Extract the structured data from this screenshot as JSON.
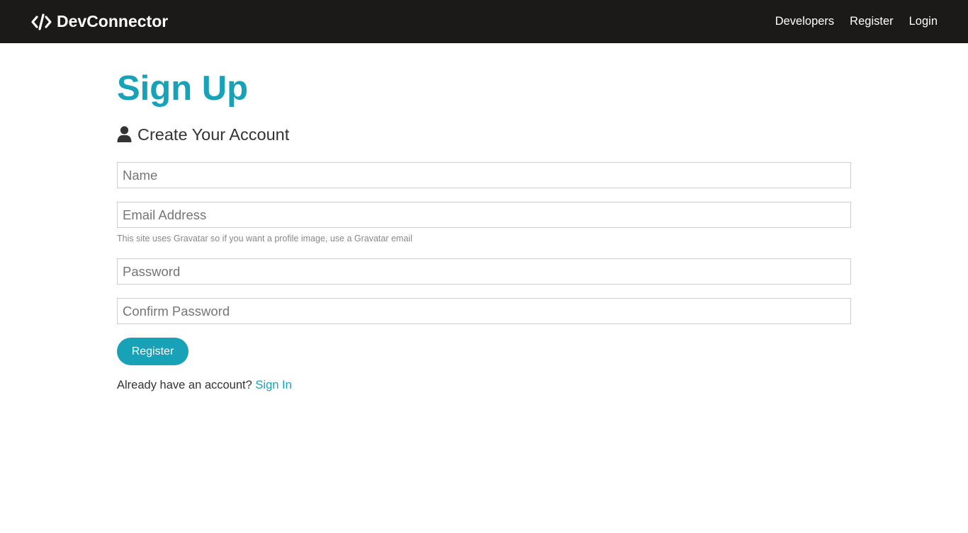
{
  "navbar": {
    "brand": "DevConnector",
    "links": [
      "Developers",
      "Register",
      "Login"
    ]
  },
  "page": {
    "title": "Sign Up",
    "lead": "Create Your Account"
  },
  "form": {
    "name_placeholder": "Name",
    "email_placeholder": "Email Address",
    "email_help": "This site uses Gravatar so if you want a profile image, use a Gravatar email",
    "password_placeholder": "Password",
    "confirm_password_placeholder": "Confirm Password",
    "submit_label": "Register"
  },
  "signin": {
    "prompt": "Already have an account?",
    "link": "Sign In"
  },
  "colors": {
    "navbar_bg": "#1c1a19",
    "primary": "#17a2b8",
    "text": "#333333"
  },
  "icons": {
    "brand": "code-icon",
    "lead": "user-icon"
  }
}
